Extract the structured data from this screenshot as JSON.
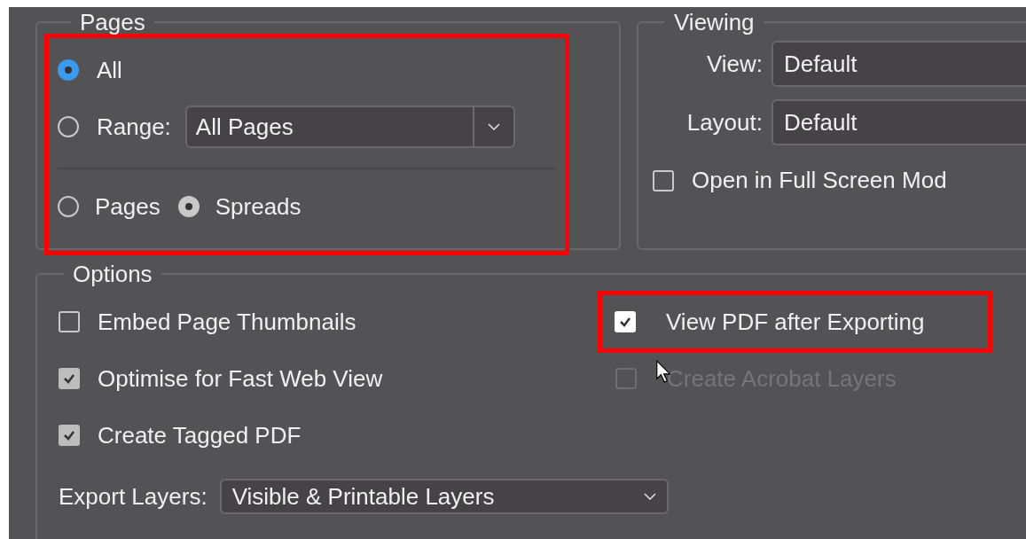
{
  "pages": {
    "title": "Pages",
    "highlighted": true,
    "range_options": [
      {
        "kind": "radio",
        "label": "All",
        "selected": true
      },
      {
        "kind": "radio_dropdown",
        "label": "Range:",
        "selected": false,
        "value": "All Pages"
      }
    ],
    "layout_options": [
      {
        "label": "Pages",
        "selected": false,
        "disabled": false
      },
      {
        "label": "Spreads",
        "selected": true,
        "disabled": true
      }
    ]
  },
  "viewing": {
    "title": "Viewing",
    "fields": [
      {
        "label": "View:",
        "value": "Default"
      },
      {
        "label": "Layout:",
        "value": "Default"
      }
    ],
    "full_screen": {
      "label": "Open in Full Screen Mod",
      "checked": false
    }
  },
  "options": {
    "title": "Options",
    "left": [
      {
        "label": "Embed Page Thumbnails",
        "checked": false,
        "disabled": false,
        "highlighted": false
      },
      {
        "label": "Optimise for Fast Web View",
        "checked": true,
        "disabled": false,
        "highlighted": false
      },
      {
        "label": "Create Tagged PDF",
        "checked": true,
        "disabled": false,
        "highlighted": false
      }
    ],
    "right": [
      {
        "label": "View PDF after Exporting",
        "checked": true,
        "disabled": false,
        "highlighted": true
      },
      {
        "label": "Create Acrobat Layers",
        "checked": false,
        "disabled": true,
        "highlighted": false
      }
    ],
    "export_layers": {
      "label": "Export Layers:",
      "value": "Visible & Printable Layers"
    }
  }
}
